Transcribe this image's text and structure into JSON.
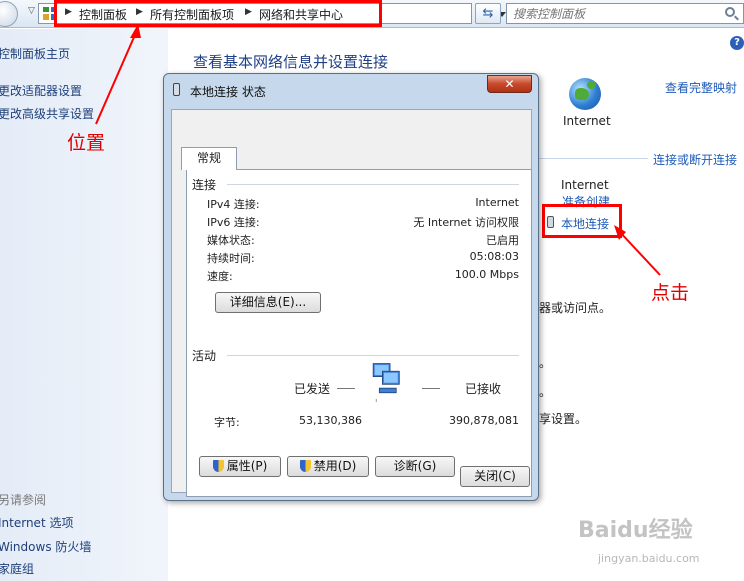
{
  "address_bar": {
    "breadcrumbs": [
      "控制面板",
      "所有控制面板项",
      "网络和共享中心"
    ],
    "refresh_icon": "refresh-icon",
    "search_placeholder": "搜索控制面板"
  },
  "left_pane": {
    "links": [
      "控制面板主页",
      "更改适配器设置",
      "更改高级共享设置"
    ],
    "see_also_title": "另请参阅",
    "see_also_links": [
      "Internet 选项",
      "Windows 防火墙",
      "家庭组"
    ]
  },
  "main": {
    "title": "查看基本网络信息并设置连接",
    "internet_label": "Internet",
    "view_full_map": "查看完整映射",
    "connect_disconnect": "连接或断开连接",
    "access_type": "Internet",
    "homegroup_partial": "准备创建",
    "local_connection_link": "本地连接",
    "fragments": [
      "器或访问点。",
      "。",
      "。",
      "享设置。"
    ]
  },
  "annotations": {
    "location_label": "位置",
    "click_label": "点击",
    "color": "#ff0000"
  },
  "dialog": {
    "title": "本地连接 状态",
    "close_glyph": "✕",
    "tab": "常规",
    "connection_group": "连接",
    "fields": [
      {
        "label": "IPv4 连接:",
        "value": "Internet"
      },
      {
        "label": "IPv6 连接:",
        "value": "无 Internet 访问权限"
      },
      {
        "label": "媒体状态:",
        "value": "已启用"
      },
      {
        "label": "持续时间:",
        "value": "05:08:03"
      },
      {
        "label": "速度:",
        "value": "100.0 Mbps"
      }
    ],
    "details_button": "详细信息(E)...",
    "activity_group": "活动",
    "sent_label": "已发送",
    "received_label": "已接收",
    "bytes_label": "字节:",
    "bytes_sent": "53,130,386",
    "bytes_received": "390,878,081",
    "properties_button": "属性(P)",
    "disable_button": "禁用(D)",
    "diagnose_button": "诊断(G)",
    "close_button": "关闭(C)"
  },
  "watermark": {
    "brand": "Baidu经验",
    "url": "jingyan.baidu.com"
  }
}
